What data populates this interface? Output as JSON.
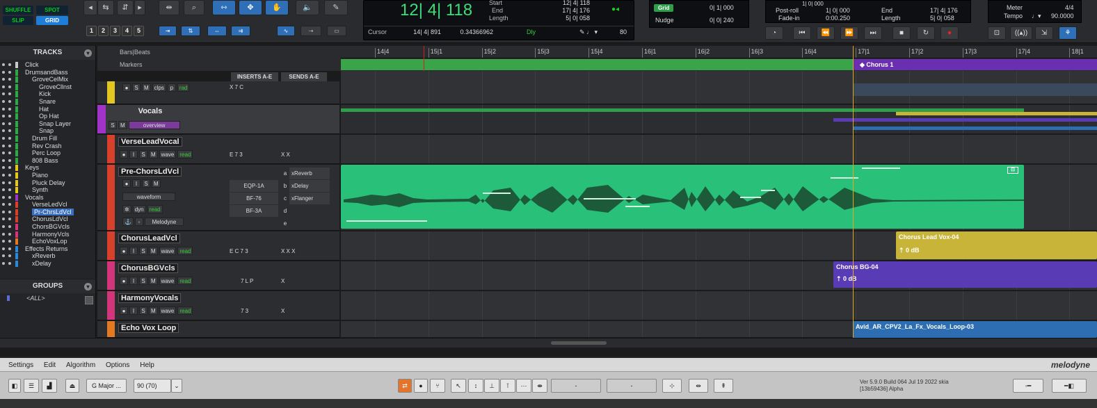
{
  "toolbar": {
    "modes": [
      "SHUFFLE",
      "SPOT",
      "SLIP",
      "GRID"
    ],
    "numbers": [
      "1",
      "2",
      "3",
      "4",
      "5"
    ]
  },
  "counter": {
    "main": "12| 4| 118",
    "start_label": "Start",
    "start_val": "12| 4| 118",
    "end_label": "End",
    "end_val": "17| 4| 176",
    "length_label": "Length",
    "length_val": "5| 0| 058",
    "cursor_label": "Cursor",
    "cursor_val": "14| 4| 891",
    "cursor_sub": "0.34366962",
    "dly_label": "Dly",
    "tempo_num": "80"
  },
  "grid": {
    "grid_label": "Grid",
    "grid_val": "0| 1| 000",
    "nudge_label": "Nudge",
    "nudge_val": "0| 0| 240"
  },
  "preroll": {
    "postroll_label": "Post-roll",
    "postroll_val": "1| 0| 000",
    "fadein_label": "Fade-in",
    "fadein_val": "0:00.250",
    "end_label": "End",
    "end_val": "17| 4| 176",
    "length_label": "Length",
    "length_val": "5| 0| 058",
    "pre_val": "1| 0| 000"
  },
  "meter": {
    "meter_label": "Meter",
    "meter_val": "4/4",
    "tempo_label": "Tempo",
    "tempo_val": "90.0000"
  },
  "tracks_panel": {
    "title": "TRACKS",
    "items": [
      {
        "name": "Click",
        "indent": 36,
        "color": "#c8c8c8"
      },
      {
        "name": "DrumsandBass",
        "indent": 36,
        "color": "#2ea845"
      },
      {
        "name": "GroveCelMix",
        "indent": 46,
        "color": "#2ea845"
      },
      {
        "name": "GroveCllnst",
        "indent": 56,
        "color": "#2ea845"
      },
      {
        "name": "Kick",
        "indent": 56,
        "color": "#2ea845"
      },
      {
        "name": "Snare",
        "indent": 56,
        "color": "#2ea845"
      },
      {
        "name": "Hat",
        "indent": 56,
        "color": "#2ea845"
      },
      {
        "name": "Op Hat",
        "indent": 56,
        "color": "#2ea845"
      },
      {
        "name": "Snap Layer",
        "indent": 56,
        "color": "#2ea845"
      },
      {
        "name": "Snap",
        "indent": 56,
        "color": "#2ea845"
      },
      {
        "name": "Drum Fill",
        "indent": 46,
        "color": "#2ea845"
      },
      {
        "name": "Rev Crash",
        "indent": 46,
        "color": "#2ea845"
      },
      {
        "name": "Perc Loop",
        "indent": 46,
        "color": "#2ea845"
      },
      {
        "name": "808 Bass",
        "indent": 46,
        "color": "#2ea845"
      },
      {
        "name": "Keys",
        "indent": 36,
        "color": "#e3c61f"
      },
      {
        "name": "Piano",
        "indent": 46,
        "color": "#e3c61f"
      },
      {
        "name": "Pluck Delay",
        "indent": 46,
        "color": "#e3c61f"
      },
      {
        "name": "Synth",
        "indent": 46,
        "color": "#e3c61f"
      },
      {
        "name": "Vocals",
        "indent": 36,
        "color": "#a233c9"
      },
      {
        "name": "VerseLedVcl",
        "indent": 46,
        "color": "#d7402a"
      },
      {
        "name": "Pr-ChrsLdVcl",
        "indent": 46,
        "color": "#d7402a",
        "selected": true
      },
      {
        "name": "ChorusLdVcl",
        "indent": 46,
        "color": "#d7402a"
      },
      {
        "name": "ChorsBGVcls",
        "indent": 46,
        "color": "#d3357a"
      },
      {
        "name": "HarmonyVcls",
        "indent": 46,
        "color": "#d3357a"
      },
      {
        "name": "EchoVoxLop",
        "indent": 46,
        "color": "#e37a22"
      },
      {
        "name": "Effects Returns",
        "indent": 36,
        "color": "#2a8ad8"
      },
      {
        "name": "xReverb",
        "indent": 46,
        "color": "#2a8ad8"
      },
      {
        "name": "xDelay",
        "indent": 46,
        "color": "#2a8ad8"
      }
    ]
  },
  "groups_panel": {
    "title": "GROUPS",
    "all_label": "<ALL>"
  },
  "ruler": {
    "bars_label": "Bars|Beats",
    "markers_label": "Markers",
    "inserts_label": "INSERTS A-E",
    "sends_label": "SENDS A-E"
  },
  "timeline_ticks": [
    "14|4",
    "15|1",
    "15|2",
    "15|3",
    "15|4",
    "16|1",
    "16|2",
    "16|3",
    "16|4",
    "17|1",
    "17|2",
    "17|3",
    "17|4",
    "18|1"
  ],
  "marker": {
    "name": "Chorus 1"
  },
  "tracks": {
    "top_ctrl": {
      "s": "S",
      "m": "M",
      "mode": "clps",
      "p": "p",
      "auto": "rad",
      "slots": "X  7  C"
    },
    "vocals": {
      "name": "Vocals",
      "s": "S",
      "m": "M",
      "view": "overview"
    },
    "verse": {
      "name": "VerseLeadVocal",
      "s": "S",
      "m": "M",
      "view": "wave",
      "auto": "read",
      "slots": "E  7  3",
      "sends": "X  X"
    },
    "prechorus": {
      "name": "Pre-ChorsLdVcl",
      "i": "I",
      "s": "S",
      "m": "M",
      "view": "waveform",
      "dyn": "dyn",
      "auto": "read",
      "plugin": "Melodyne",
      "inserts": [
        "EQP-1A",
        "BF-76",
        "BF-3A"
      ],
      "sends": [
        {
          "k": "a",
          "name": "xReverb"
        },
        {
          "k": "b",
          "name": "xDelay"
        },
        {
          "k": "c",
          "name": "xFlanger"
        },
        {
          "k": "d",
          "name": ""
        },
        {
          "k": "e",
          "name": ""
        }
      ]
    },
    "chorus_lead": {
      "name": "ChorusLeadVcl",
      "s": "S",
      "m": "M",
      "view": "wave",
      "auto": "read",
      "slots": "E  C  7  3",
      "sends": "X  X  X"
    },
    "chorus_bg": {
      "name": "ChorusBGVcls",
      "s": "S",
      "m": "M",
      "view": "wave",
      "auto": "read",
      "slots": "7  L  P",
      "sends": "X"
    },
    "harmony": {
      "name": "HarmonyVocals",
      "s": "S",
      "m": "M",
      "view": "wave",
      "auto": "read",
      "slots": "7  3",
      "sends": "X"
    },
    "echo": {
      "name": "Echo Vox Loop"
    }
  },
  "clips": {
    "chorus_lead": {
      "name": "Chorus Lead Vox-04",
      "gain": "0 dB",
      "color": "#c9b43a"
    },
    "chorus_bg": {
      "name": "Chorus BG-04",
      "gain": "0 dB",
      "color": "#5a3bb6"
    },
    "echo": {
      "name": "Avid_AR_CPV2_La_Fx_Vocals_Loop-03",
      "color": "#2d6db1"
    },
    "prechorus_color": "#29c07a"
  },
  "melodyne": {
    "menu": [
      "Settings",
      "Edit",
      "Algorithm",
      "Options",
      "Help"
    ],
    "logo": "melodyne",
    "key": "G Major ...",
    "tempo": "90 (70)",
    "field_a": "-",
    "field_b": "-",
    "version": "Ver 5.9.0 Build 064 Jul 19 2022 skia",
    "build": "[13b59436] Alpha"
  }
}
